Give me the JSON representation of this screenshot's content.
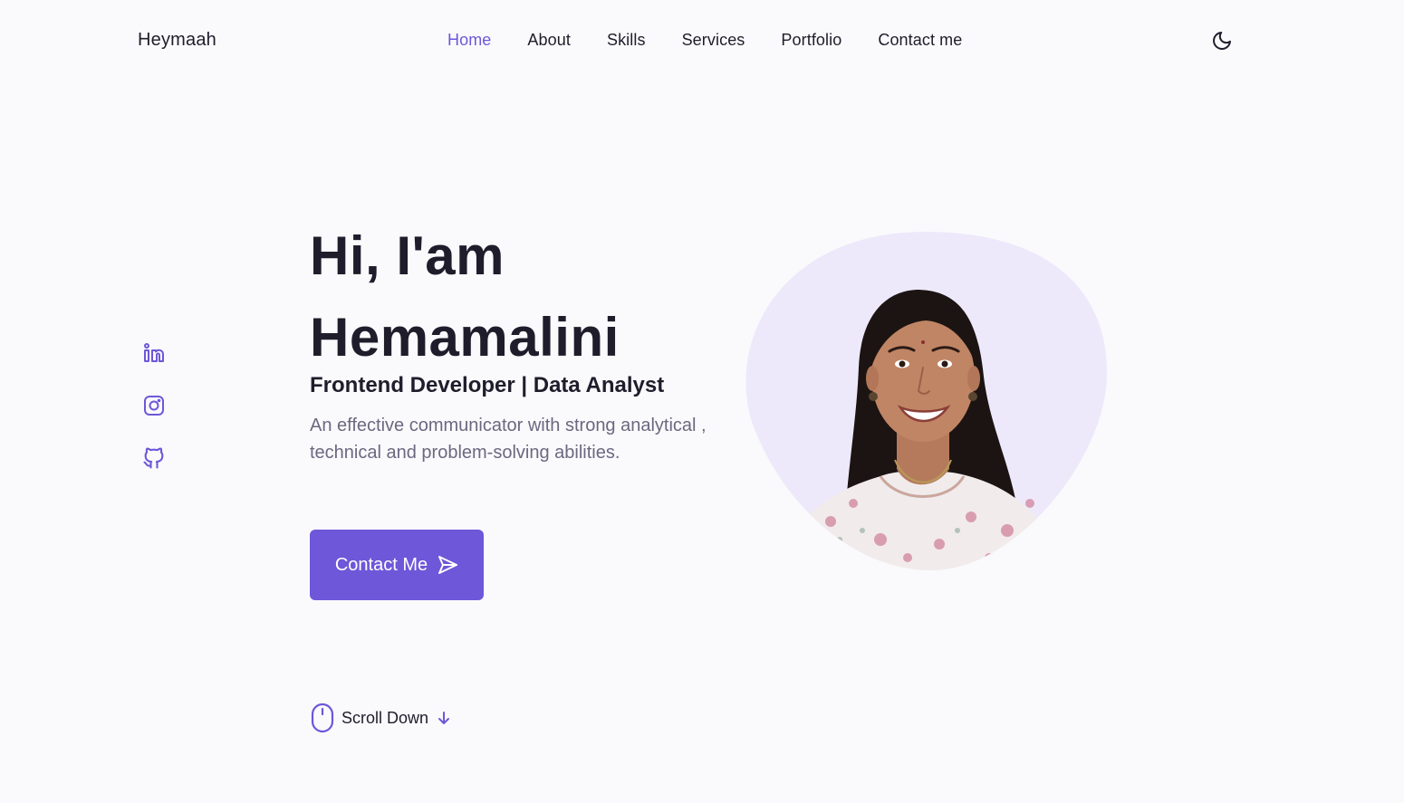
{
  "header": {
    "logo": "Heymaah",
    "nav": [
      {
        "label": "Home",
        "active": true
      },
      {
        "label": "About"
      },
      {
        "label": "Skills"
      },
      {
        "label": "Services"
      },
      {
        "label": "Portfolio"
      },
      {
        "label": "Contact me"
      }
    ],
    "theme_icon": "moon-icon"
  },
  "social": [
    "linkedin-icon",
    "instagram-icon",
    "github-icon"
  ],
  "hero": {
    "greeting": "Hi, I'am",
    "name": "Hemamalini",
    "subtitle": "Frontend Developer | Data Analyst",
    "description": "An effective communicator with strong analytical , technical and problem-solving abilities.",
    "cta_label": "Contact Me",
    "cta_icon": "send-icon",
    "image": "profile-photo"
  },
  "scroll": {
    "label": "Scroll Down",
    "mouse_icon": "mouse-icon",
    "arrow_icon": "arrow-down-icon"
  },
  "colors": {
    "accent": "#6e57d9",
    "text": "#1f1d2b",
    "muted": "#6b6880",
    "blob": "#ede9fb",
    "background": "#fafafc"
  }
}
